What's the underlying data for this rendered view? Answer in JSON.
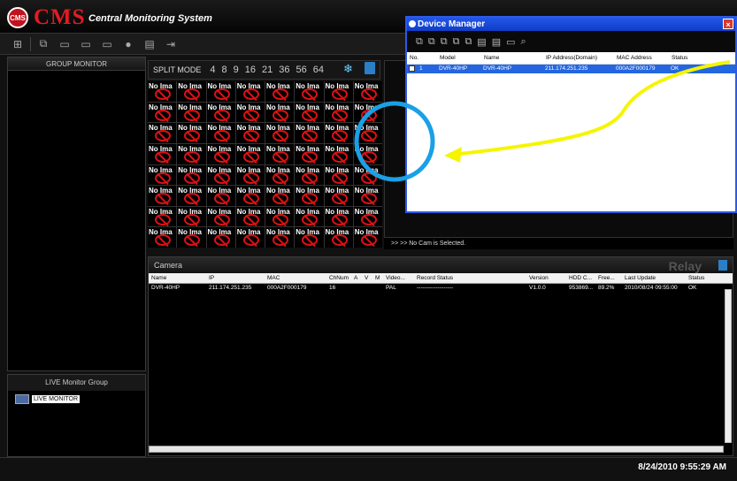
{
  "app": {
    "logo_badge": "CMS",
    "logo_text": "CMS",
    "subtitle": "Central Monitoring System"
  },
  "group_monitor": {
    "title": "GROUP MONITOR"
  },
  "live_group": {
    "title": "LIVE Monitor Group",
    "item": "LIVE MONITOR"
  },
  "split": {
    "label": "SPLIT MODE",
    "modes": [
      "4",
      "8",
      "9",
      "16",
      "21",
      "36",
      "56",
      "64"
    ]
  },
  "grid": {
    "cell_text": "No Ima",
    "rows": 8,
    "cols": 8
  },
  "status_nocam": ">> >> No Cam is Selected.",
  "camera": {
    "title": "Camera",
    "relay": "Relay",
    "columns": [
      "Name",
      "IP",
      "MAC",
      "ChNum",
      "A",
      "V",
      "M",
      "Video...",
      "Record Status",
      "Version",
      "HDD C...",
      "Free...",
      "Last Update",
      "Status"
    ],
    "row": [
      "DVR-40HP",
      "211.174.251.235",
      "000A2F000179",
      "16",
      "",
      "",
      "",
      "PAL",
      "-------------------",
      "V1.0.0",
      "953869...",
      "89.2%",
      "2010/08/24 09:55:00",
      "OK"
    ]
  },
  "device_manager": {
    "title": "Device Manager",
    "columns": [
      "No.",
      "Model",
      "Name",
      "IP Address(Domain)",
      "MAC Address",
      "Status"
    ],
    "row": [
      "1",
      "DVR-40HP",
      "DVR-40HP",
      "211.174.251.235",
      "000A2F000179",
      "OK"
    ]
  },
  "clock": "8/24/2010 9:55:29 AM",
  "colors": {
    "accent": "#e31b23",
    "dialog": "#2c5ae8",
    "annotation_circle": "#1aa0e6",
    "annotation_arrow": "#f5f500"
  }
}
